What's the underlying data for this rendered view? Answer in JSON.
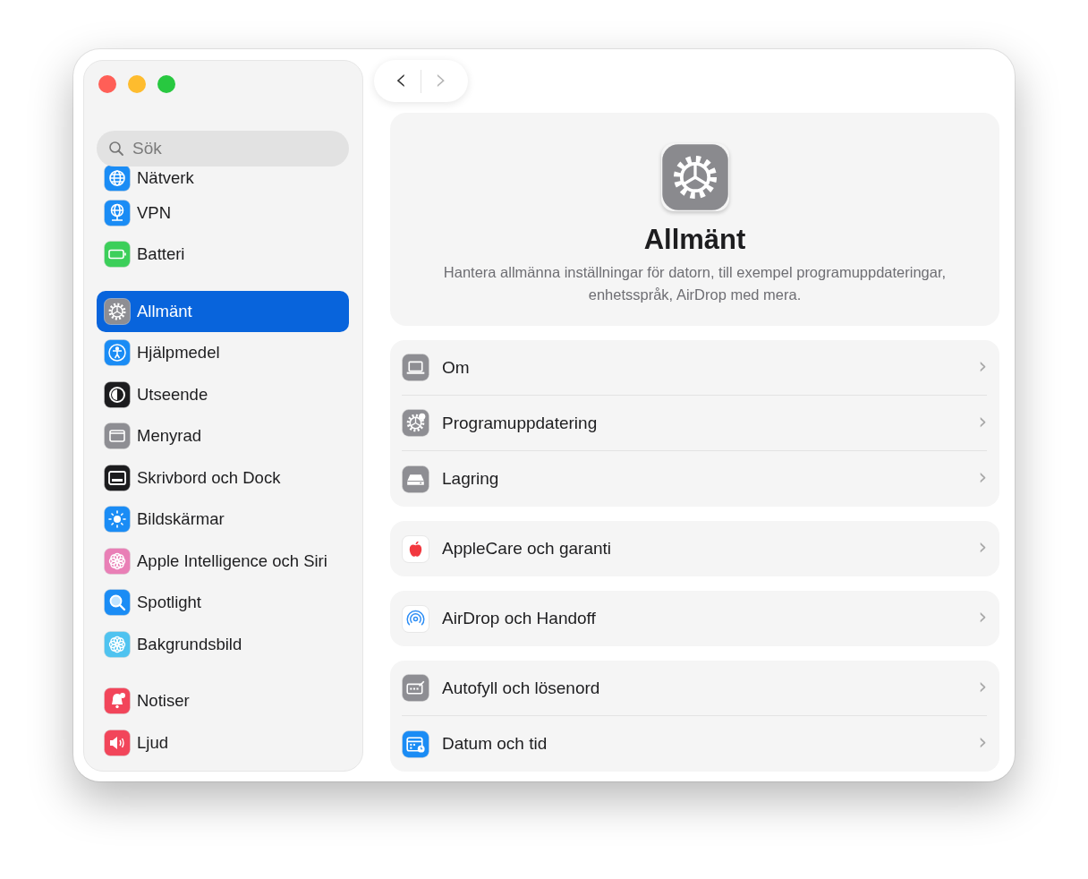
{
  "sidebar": {
    "search": {
      "placeholder": "Sök"
    },
    "groups": [
      [
        {
          "label": "Nätverk",
          "kind": "globe",
          "color": "#1a8cf5",
          "selected": false
        },
        {
          "label": "VPN",
          "kind": "globe-stand",
          "color": "#1a8cf5",
          "selected": false
        },
        {
          "label": "Batteri",
          "kind": "battery",
          "color": "#3ccf5a",
          "selected": false
        }
      ],
      [
        {
          "label": "Allmänt",
          "kind": "gear",
          "color": "#8e8e93",
          "selected": true
        },
        {
          "label": "Hjälpmedel",
          "kind": "person",
          "color": "#1a8cf5",
          "selected": false
        },
        {
          "label": "Utseende",
          "kind": "half-circle",
          "color": "#1c1c1e",
          "selected": false
        },
        {
          "label": "Menyrad",
          "kind": "window",
          "color": "#8e8e93",
          "selected": false
        },
        {
          "label": "Skrivbord och Dock",
          "kind": "dock",
          "color": "#1c1c1e",
          "selected": false
        },
        {
          "label": "Bildskärmar",
          "kind": "sun",
          "color": "#1a8cf5",
          "selected": false
        },
        {
          "label": "Apple Intelligence och Siri",
          "kind": "flower-ring",
          "color": "#e97fb6",
          "selected": false
        },
        {
          "label": "Spotlight",
          "kind": "magnifier",
          "color": "#1a8cf5",
          "selected": false
        },
        {
          "label": "Bakgrundsbild",
          "kind": "flower",
          "color": "#4fc3f0",
          "selected": false
        }
      ],
      [
        {
          "label": "Notiser",
          "kind": "bell",
          "color": "#f2455a",
          "selected": false
        },
        {
          "label": "Ljud",
          "kind": "speaker",
          "color": "#f2455a",
          "selected": false
        }
      ]
    ]
  },
  "toolbar": {
    "back": {
      "label": "‹",
      "disabled": false
    },
    "forward": {
      "label": "›",
      "disabled": true
    }
  },
  "header": {
    "kind": "gear",
    "title": "Allmänt",
    "description": "Hantera allmänna inställningar för datorn, till exempel programuppdateringar, enhetsspråk, AirDrop med mera."
  },
  "groups": [
    [
      {
        "label": "Om",
        "kind": "laptop",
        "color": "#8e8e93",
        "chevron": "›"
      },
      {
        "label": "Programuppdatering",
        "kind": "gear-badge",
        "color": "#8e8e93",
        "chevron": "›"
      },
      {
        "label": "Lagring",
        "kind": "drive",
        "color": "#8e8e93",
        "chevron": "›"
      }
    ],
    [
      {
        "label": "AppleCare och garanti",
        "kind": "apple",
        "color": "#ffffff",
        "chevron": "›"
      }
    ],
    [
      {
        "label": "AirDrop och Handoff",
        "kind": "rings",
        "color": "#ffffff",
        "chevron": "›"
      }
    ],
    [
      {
        "label": "Autofyll och lösenord",
        "kind": "keyboard",
        "color": "#8e8e93",
        "chevron": "›"
      },
      {
        "label": "Datum och tid",
        "kind": "calendar",
        "color": "#1a8cf5",
        "chevron": "›"
      }
    ]
  ]
}
